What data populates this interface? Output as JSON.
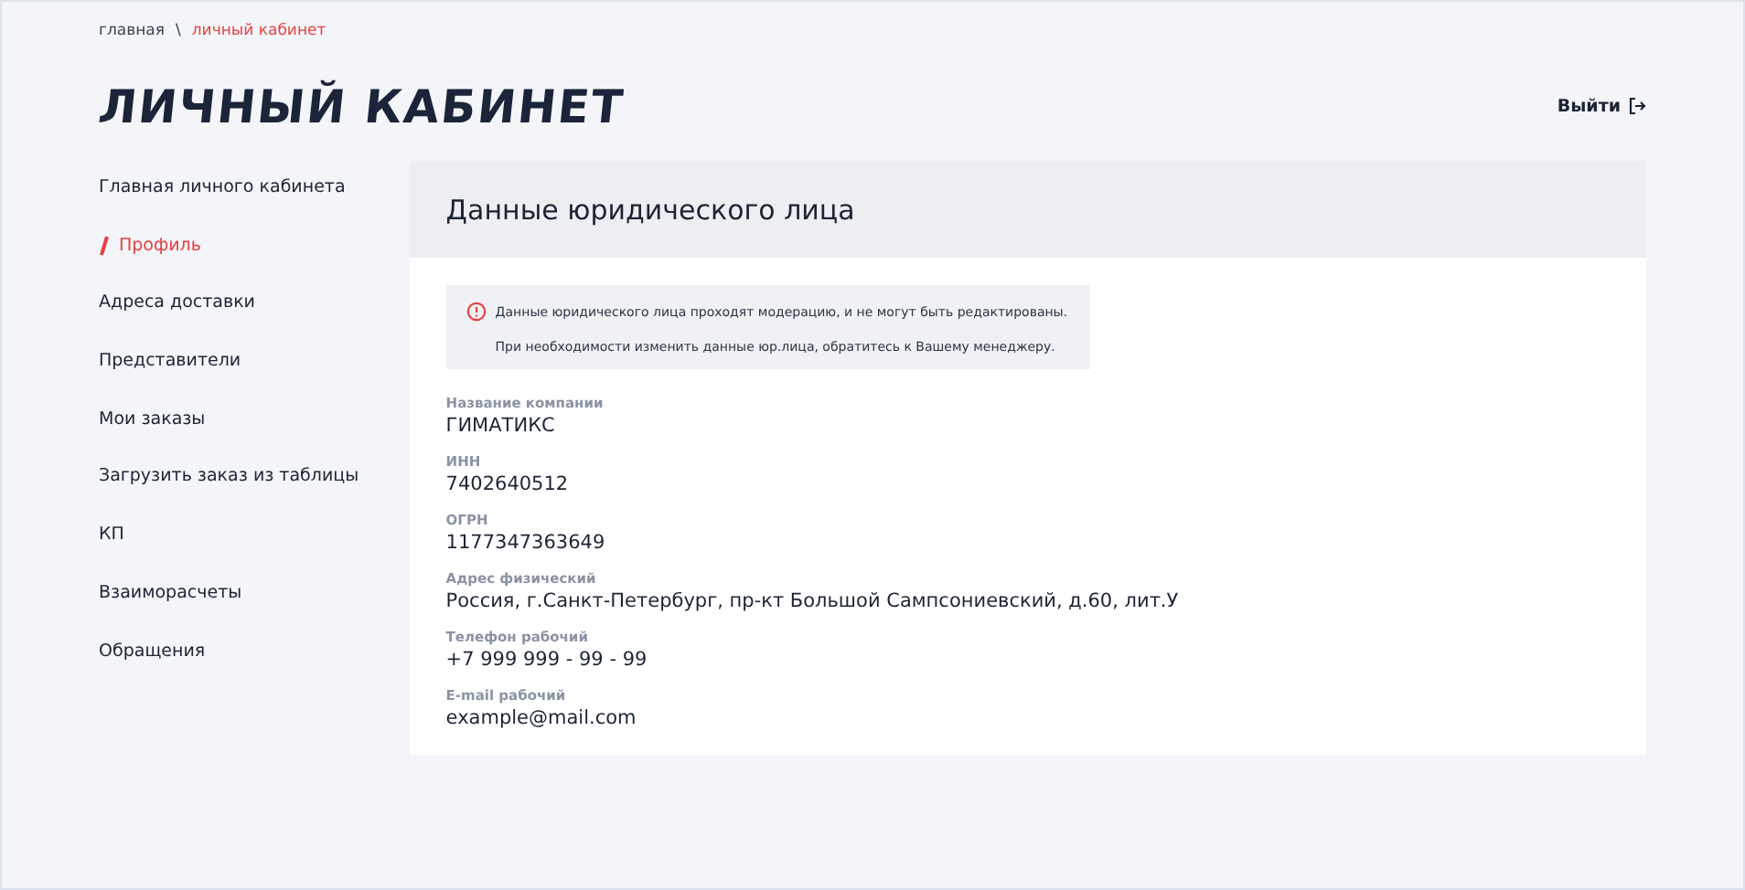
{
  "breadcrumbs": [
    {
      "label": "главная",
      "selected": false
    },
    {
      "label": "личный кабинет",
      "selected": true
    }
  ],
  "breadcrumb_separator": "\\",
  "page_title": "ЛИЧНЫЙ КАБИНЕТ",
  "logout": {
    "label": "Выйти"
  },
  "sidebar": {
    "items": [
      {
        "label": "Главная личного кабинета",
        "selected": false
      },
      {
        "label": "Профиль",
        "selected": true
      },
      {
        "label": "Адреса доставки",
        "selected": false
      },
      {
        "label": "Представители",
        "selected": false
      },
      {
        "label": "Мои заказы",
        "selected": false
      },
      {
        "label": "Загрузить заказ из таблицы",
        "selected": false
      },
      {
        "label": "КП",
        "selected": false
      },
      {
        "label": "Взаиморасчеты",
        "selected": false
      },
      {
        "label": "Обращения",
        "selected": false
      }
    ]
  },
  "panel": {
    "title": "Данные юридического лица",
    "notice": [
      "Данные юридического лица проходят модерацию, и не могут быть редактированы.",
      "При необходимости изменить данные юр.лица, обратитесь к Вашему менеджеру."
    ],
    "fields": [
      {
        "label": "Название компании",
        "value": "ГИМАТИКС"
      },
      {
        "label": "ИНН",
        "value": "7402640512"
      },
      {
        "label": "ОГРН",
        "value": "1177347363649"
      },
      {
        "label": "Адрес физический",
        "value": "Россия, г.Санкт-Петербург, пр-кт Большой Сампсониевский, д.60, лит.У"
      },
      {
        "label": "Телефон рабочий",
        "value": "+7 999 999 - 99 - 99"
      },
      {
        "label": "E-mail рабочий",
        "value": "example@mail.com"
      }
    ]
  }
}
